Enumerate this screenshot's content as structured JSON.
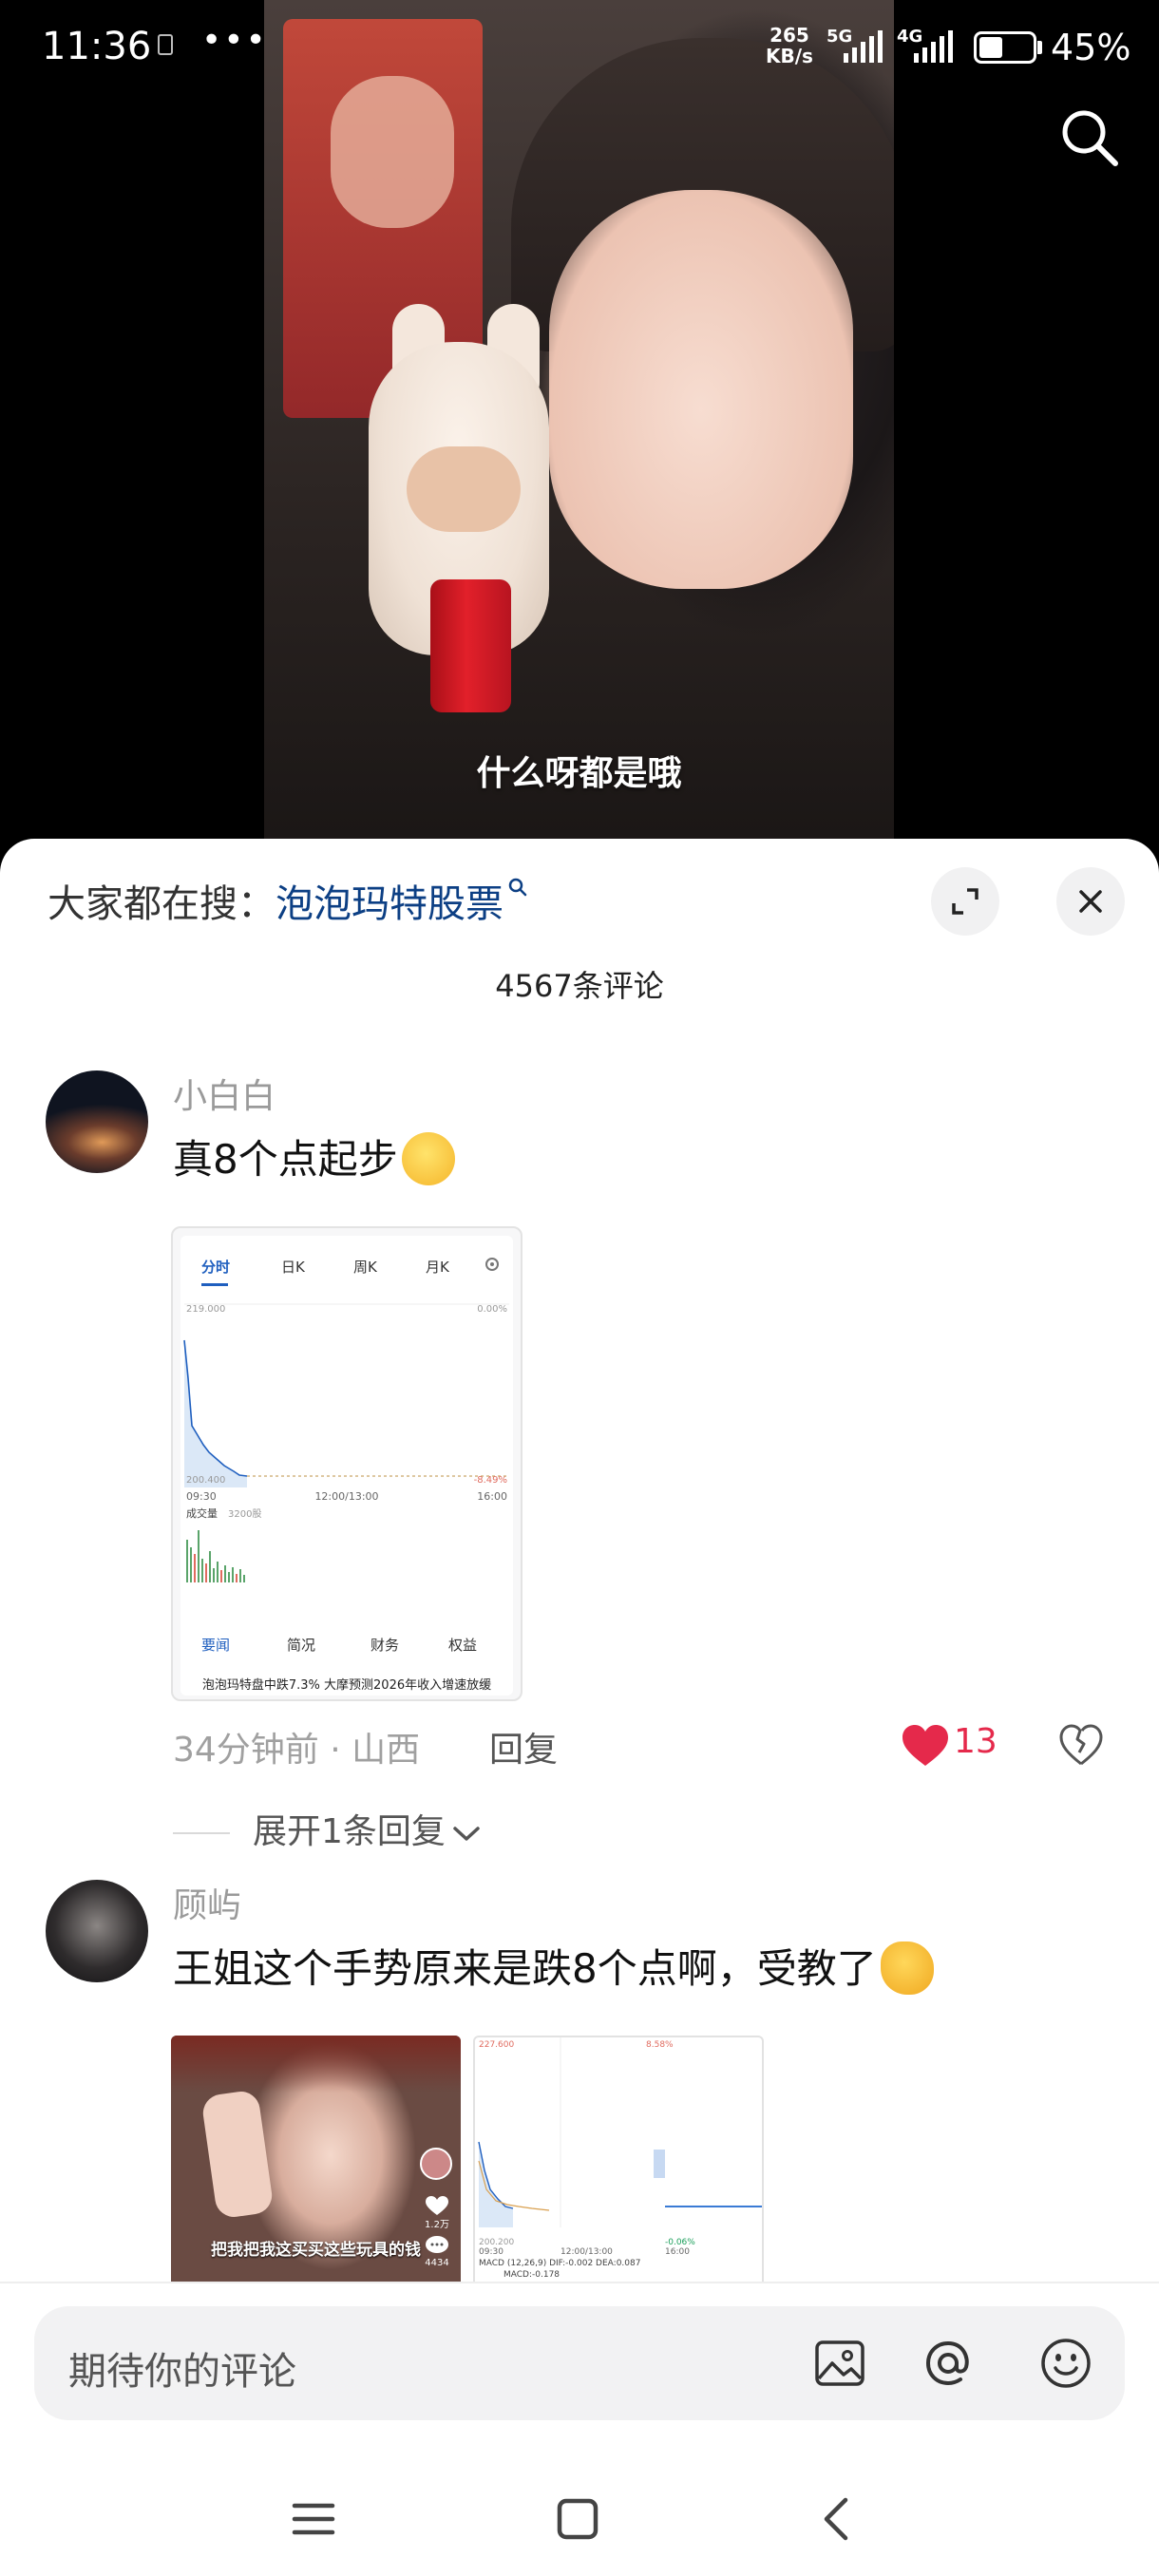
{
  "status_bar": {
    "time": "11:36",
    "dots": "•••",
    "network_speed_value": "265",
    "network_speed_unit": "KB/s",
    "signal_1_label": "5G",
    "signal_2_label": "4G",
    "battery_percent": "45%",
    "battery_level": 0.45
  },
  "video": {
    "caption": "什么呀都是哦"
  },
  "sheet": {
    "hot_search_prefix": "大家都在搜：",
    "hot_search_term": "泡泡玛特股票",
    "comment_count": "4567条评论"
  },
  "comments": [
    {
      "username": "小白白",
      "text": "真8个点起步",
      "stock_card": {
        "tabs": [
          "分时",
          "日K",
          "周K",
          "月K"
        ],
        "price_top": "219.000",
        "pct_top": "0.00%",
        "price_bottom": "200.400",
        "pct_bottom": "-8.49%",
        "time_start": "09:30",
        "time_mid": "12:00/13:00",
        "time_end": "16:00",
        "volume_label": "成交量",
        "volume_value": "3200股",
        "bottom_tabs": [
          "要闻",
          "简况",
          "财务",
          "权益"
        ],
        "news_headline": "泡泡玛特盘中跌7.3% 大摩预测2026年收入增速放缓"
      },
      "meta": "34分钟前 · 山西",
      "reply_label": "回复",
      "likes": "13",
      "expand_replies": "展开1条回复"
    },
    {
      "username": "顾屿",
      "text": "王姐这个手势原来是跌8个点啊，受教了",
      "thumb_caption": "把我把我这买买这些玩具的钱",
      "thumb_likes": "1.2万",
      "thumb_comments": "4434",
      "thumb_chart": {
        "price_top": "227.600",
        "pct_top": "8.58%",
        "price_bottom": "200.200",
        "pct_bottom": "-0.06%",
        "time_start": "09:30",
        "time_mid": "12:00/13:00",
        "time_end": "16:00",
        "macd_text": "MACD (12,26,9) DIF:-0.002 DEA:0.087",
        "macd_value": "MACD:-0.178"
      }
    }
  ],
  "input": {
    "placeholder": "期待你的评论"
  },
  "colors": {
    "link_blue": "#0c3f84",
    "like_red": "#e5294b",
    "chart_blue": "#1f5fbf"
  },
  "icons": {
    "search": "search-icon",
    "expand": "expand-icon",
    "close": "close-icon",
    "heart": "heart-icon",
    "dislike": "broken-heart-icon",
    "image": "image-icon",
    "mention": "at-icon",
    "emoji": "emoji-icon",
    "menu": "menu-icon",
    "home": "home-icon",
    "back": "back-icon"
  }
}
